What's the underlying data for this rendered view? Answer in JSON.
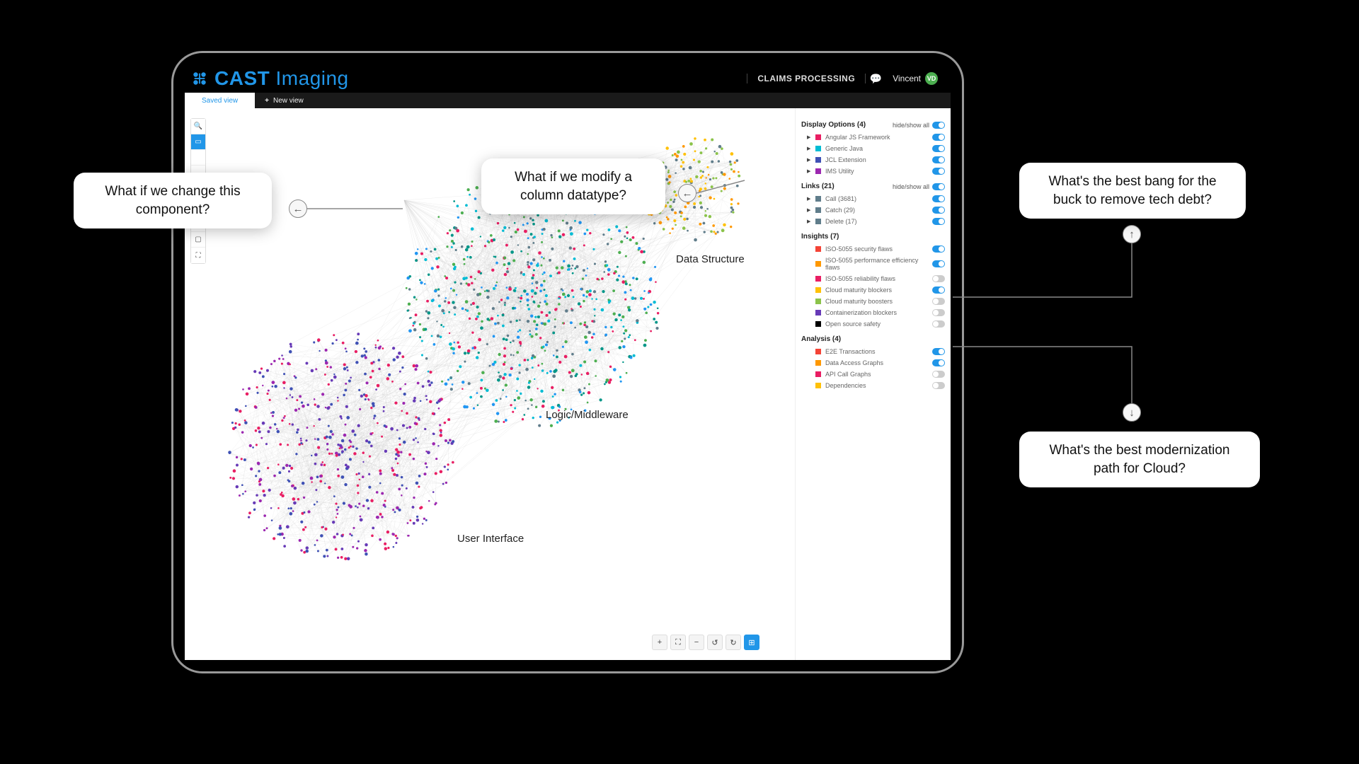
{
  "app": {
    "brand_strong": "CAST",
    "brand_light": "Imaging",
    "project": "CLAIMS PROCESSING",
    "user_name": "Vincent",
    "avatar_initials": "VD"
  },
  "tabs": {
    "active": "Saved view",
    "new_label": "New view"
  },
  "panel": {
    "display": {
      "title": "Display Options (4)",
      "hideshow": "hide/show all",
      "items": [
        {
          "label": "Angular JS Framework",
          "color": "#e91e63",
          "on": true
        },
        {
          "label": "Generic Java",
          "color": "#00bcd4",
          "on": true
        },
        {
          "label": "JCL Extension",
          "color": "#3f51b5",
          "on": true
        },
        {
          "label": "IMS Utility",
          "color": "#9c27b0",
          "on": true
        }
      ]
    },
    "links": {
      "title": "Links (21)",
      "hideshow": "hide/show all",
      "items": [
        {
          "label": "Call (3681)",
          "color": "#607d8b",
          "on": true
        },
        {
          "label": "Catch (29)",
          "color": "#607d8b",
          "on": true
        },
        {
          "label": "Delete (17)",
          "color": "#607d8b",
          "on": true
        }
      ]
    },
    "insights": {
      "title": "Insights (7)",
      "items": [
        {
          "label": "ISO-5055 security flaws",
          "color": "#f44336",
          "on": true
        },
        {
          "label": "ISO-5055 performance efficiency flaws",
          "color": "#ff9800",
          "on": true
        },
        {
          "label": "ISO-5055 reliability flaws",
          "color": "#e91e63",
          "on": false
        },
        {
          "label": "Cloud maturity blockers",
          "color": "#ffc107",
          "on": true
        },
        {
          "label": "Cloud maturity boosters",
          "color": "#8bc34a",
          "on": false
        },
        {
          "label": "Containerization blockers",
          "color": "#673ab7",
          "on": false
        },
        {
          "label": "Open source safety",
          "color": "#000000",
          "on": false
        }
      ]
    },
    "analysis": {
      "title": "Analysis (4)",
      "items": [
        {
          "label": "E2E Transactions",
          "color": "#f44336",
          "on": true
        },
        {
          "label": "Data Access Graphs",
          "color": "#ff9800",
          "on": true
        },
        {
          "label": "API Call Graphs",
          "color": "#e91e63",
          "on": false
        },
        {
          "label": "Dependencies",
          "color": "#ffc107",
          "on": false
        }
      ]
    }
  },
  "clusters": {
    "ui": "User Interface",
    "logic": "Logic/Middleware",
    "data": "Data Structure"
  },
  "callouts": {
    "c1": "What if we  change this component?",
    "c2": "What if we modify a column  datatype?",
    "c3": "What's the best bang for the buck to remove tech debt?",
    "c4": "What's the best modernization path for Cloud?"
  },
  "toolbar_v": [
    "search",
    "cursor",
    "divider",
    "divider",
    "rect",
    "square",
    "maximize"
  ],
  "toolbar_h": [
    "+",
    "⛶",
    "−",
    "↺",
    "↻",
    "⊞"
  ]
}
